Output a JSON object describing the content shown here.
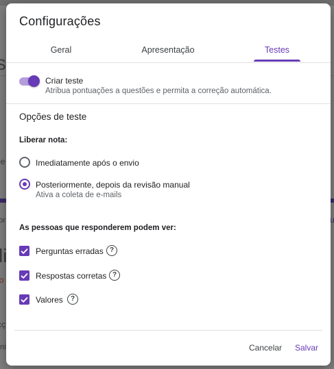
{
  "background": {
    "fragments": [
      "Sp",
      "le",
      "or",
      "li",
      "lo",
      "çç",
      "oni",
      "u"
    ]
  },
  "dialog": {
    "title": "Configurações",
    "tabs": [
      {
        "label": "Geral"
      },
      {
        "label": "Apresentação"
      },
      {
        "label": "Testes"
      }
    ],
    "active_tab": "Testes",
    "quiz_toggle": {
      "label": "Criar teste",
      "description": "Atribua pontuações a questões e permita a correção automática.",
      "enabled": true
    },
    "section_title": "Opções de teste",
    "release_grade": {
      "heading": "Liberar nota:",
      "options": [
        {
          "label": "Imediatamente após o envio",
          "selected": false
        },
        {
          "label": "Posteriormente, depois da revisão manual",
          "description": "Ativa a coleta de e-mails",
          "selected": true
        }
      ]
    },
    "respondent_view": {
      "heading": "As pessoas que responderem podem ver:",
      "items": [
        {
          "label": "Perguntas erradas",
          "checked": true
        },
        {
          "label": "Respostas corretas",
          "checked": true
        },
        {
          "label": "Valores",
          "checked": true
        }
      ],
      "help_glyph": "?"
    },
    "buttons": {
      "cancel": "Cancelar",
      "save": "Salvar"
    }
  },
  "colors": {
    "accent": "#673ab7",
    "accent_light": "#b39ddb",
    "text": "#202124",
    "muted": "#5f6368"
  },
  "icons": {
    "checkbox": "check-icon",
    "help": "help-circle-icon"
  }
}
